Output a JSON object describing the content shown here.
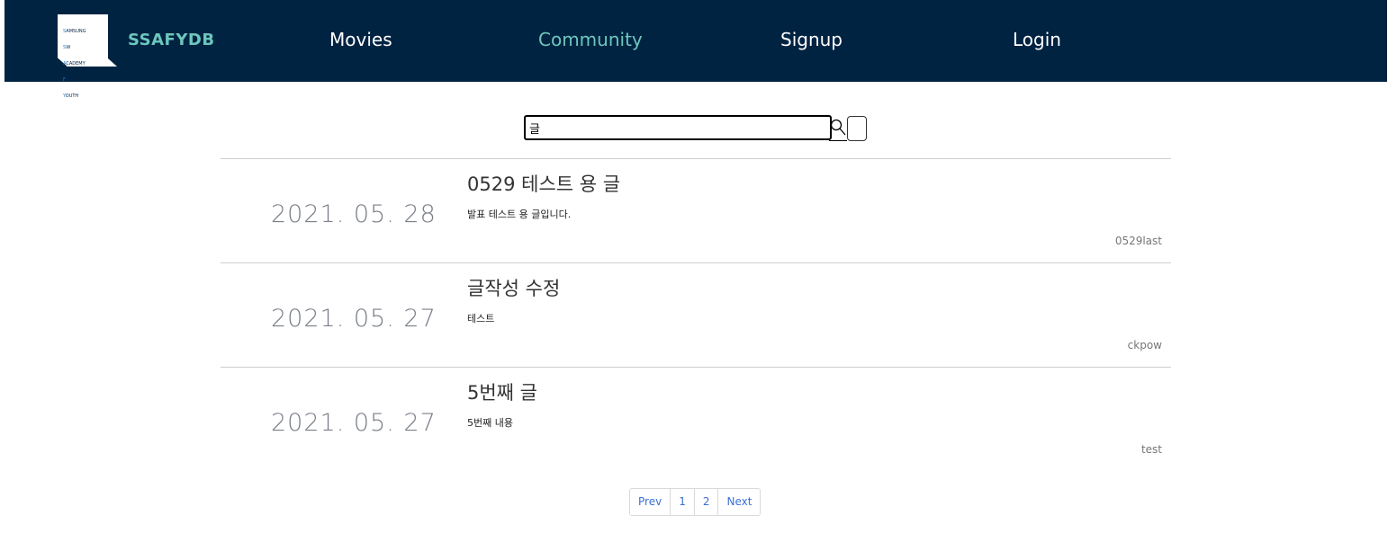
{
  "navbar": {
    "logo_lines": [
      "SAMSUNG",
      "SW",
      "ACADEMY",
      "FOR",
      "YOUTH"
    ],
    "brand": "SSAFYDB",
    "links": [
      {
        "label": "Movies",
        "active": false
      },
      {
        "label": "Community",
        "active": true
      },
      {
        "label": "Signup",
        "active": false
      },
      {
        "label": "Login",
        "active": false
      }
    ],
    "background_color": "#002342",
    "accent_color": "#6cc7bd"
  },
  "search": {
    "value": "글",
    "icon": "search-icon"
  },
  "posts": [
    {
      "date": "2021. 05. 28",
      "title": "0529 테스트 용 글",
      "body": "발표 테스트 용 글입니다.",
      "author": "0529last"
    },
    {
      "date": "2021. 05. 27",
      "title": "글작성 수정",
      "body": "테스트",
      "author": "ckpow"
    },
    {
      "date": "2021. 05. 27",
      "title": "5번째 글",
      "body": "5번째 내용",
      "author": "test"
    }
  ],
  "pagination": {
    "prev": "Prev",
    "pages": [
      "1",
      "2"
    ],
    "next": "Next"
  }
}
